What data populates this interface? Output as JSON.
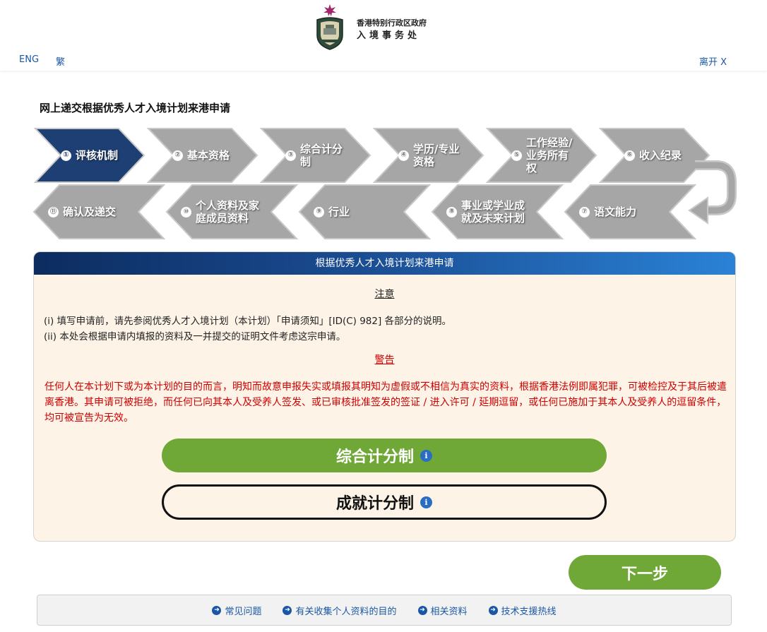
{
  "header": {
    "dept_small": "香港特别行政区政府",
    "dept_big": "入境事务处",
    "lang_eng": "ENG",
    "lang_trad": "繁",
    "exit": "离开 X"
  },
  "page_title": "网上递交根据优秀人才入境计划来港申请",
  "steps": [
    {
      "num": "1",
      "label": "评核机制",
      "active": true
    },
    {
      "num": "2",
      "label": "基本资格"
    },
    {
      "num": "3",
      "label": "综合计分制"
    },
    {
      "num": "4",
      "label": "学历/专业资格"
    },
    {
      "num": "5",
      "label": "工作经验/业务所有权"
    },
    {
      "num": "6",
      "label": "收入纪录"
    },
    {
      "num": "7",
      "label": "语文能力"
    },
    {
      "num": "8",
      "label": "事业或学业成就及未来计划"
    },
    {
      "num": "9",
      "label": "行业"
    },
    {
      "num": "10",
      "label": "个人资料及家庭成员资料"
    },
    {
      "num": "11",
      "label": "确认及递交"
    }
  ],
  "panel": {
    "heading": "根据优秀人才入境计划来港申请",
    "notice_title": "注意",
    "notes": [
      "(i)  填写申请前，请先参阅优秀人才入境计划（本计划）「申请须知」[ID(C) 982] 各部分的说明。",
      "(ii)  本处会根据申请内填报的资料及一并提交的证明文件考虑这宗申请。"
    ],
    "warning_title": "警告",
    "warning_text": "任何人在本计划下或为本计划的目的而言，明知而故意申报失实或填报其明知为虚假或不相信为真实的资料，根据香港法例即属犯罪，可被检控及于其后被遣离香港。其申请可被拒绝，而任何已向其本人及受养人签发、或已审核批准签发的签证 / 进入许可 / 延期逗留，或任何已施加于其本人及受养人的逗留条件，均可被宣告为无效。",
    "option_points": "综合计分制",
    "option_achievement": "成就计分制"
  },
  "next_button": "下一步",
  "footer_links": [
    "常见问题",
    "有关收集个人资料的目的",
    "相关资料",
    "技术支援热线"
  ],
  "colors": {
    "accent_green": "#6fa836",
    "active_step": "#1e3f73",
    "inactive_step": "#a6a6a6",
    "warning_red": "#d00000"
  }
}
